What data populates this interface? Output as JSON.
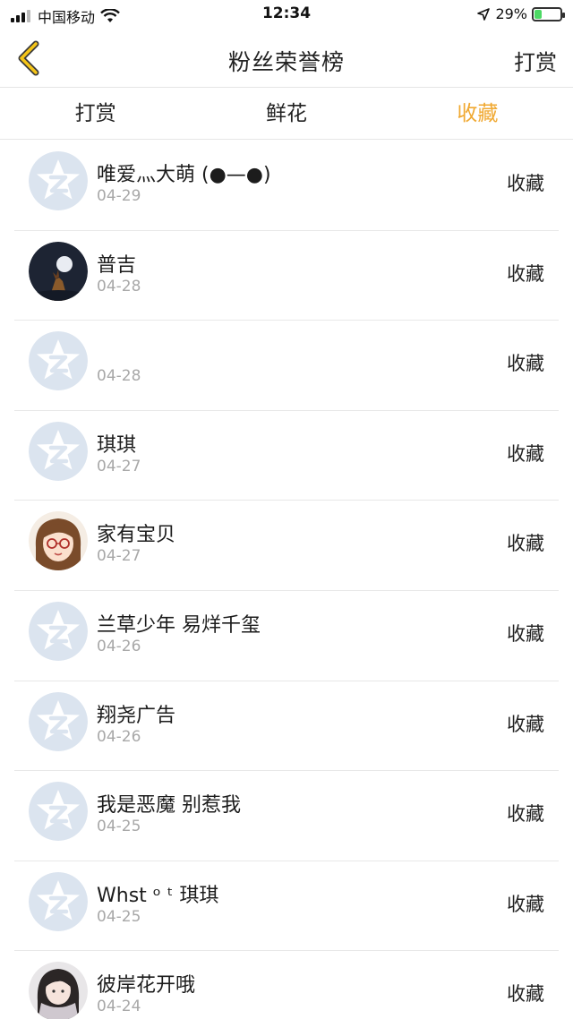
{
  "status_bar": {
    "carrier": "中国移动",
    "time": "12:34",
    "battery": "29%",
    "battery_level": 0.29
  },
  "nav": {
    "title": "粉丝荣誉榜",
    "right_action": "打赏"
  },
  "tabs": [
    {
      "label": "打赏",
      "active": false
    },
    {
      "label": "鲜花",
      "active": false
    },
    {
      "label": "收藏",
      "active": true
    }
  ],
  "colors": {
    "accent": "#f0a830",
    "default_avatar": "#dbe4ef"
  },
  "fans": [
    {
      "name": "唯爱灬大萌 (●—●)",
      "date": "04-29",
      "action": "收藏",
      "avatar": "default-avatar"
    },
    {
      "name": "普吉",
      "date": "04-28",
      "action": "收藏",
      "avatar": "moon-night-avatar"
    },
    {
      "name": "",
      "date": "04-28",
      "action": "收藏",
      "avatar": "default-avatar"
    },
    {
      "name": "琪琪",
      "date": "04-27",
      "action": "收藏",
      "avatar": "default-avatar"
    },
    {
      "name": "家有宝贝",
      "date": "04-27",
      "action": "收藏",
      "avatar": "girl-glasses-avatar"
    },
    {
      "name": "兰草少年 易烊千玺",
      "date": "04-26",
      "action": "收藏",
      "avatar": "default-avatar"
    },
    {
      "name": "翔尧广告",
      "date": "04-26",
      "action": "收藏",
      "avatar": "default-avatar"
    },
    {
      "name": "我是恶魔 别惹我",
      "date": "04-25",
      "action": "收藏",
      "avatar": "default-avatar"
    },
    {
      "name": "Whst ᵒ ᵗ 琪琪",
      "date": "04-25",
      "action": "收藏",
      "avatar": "default-avatar"
    },
    {
      "name": "彼岸花开哦",
      "date": "04-24",
      "action": "收藏",
      "avatar": "girl-scarf-avatar"
    }
  ]
}
